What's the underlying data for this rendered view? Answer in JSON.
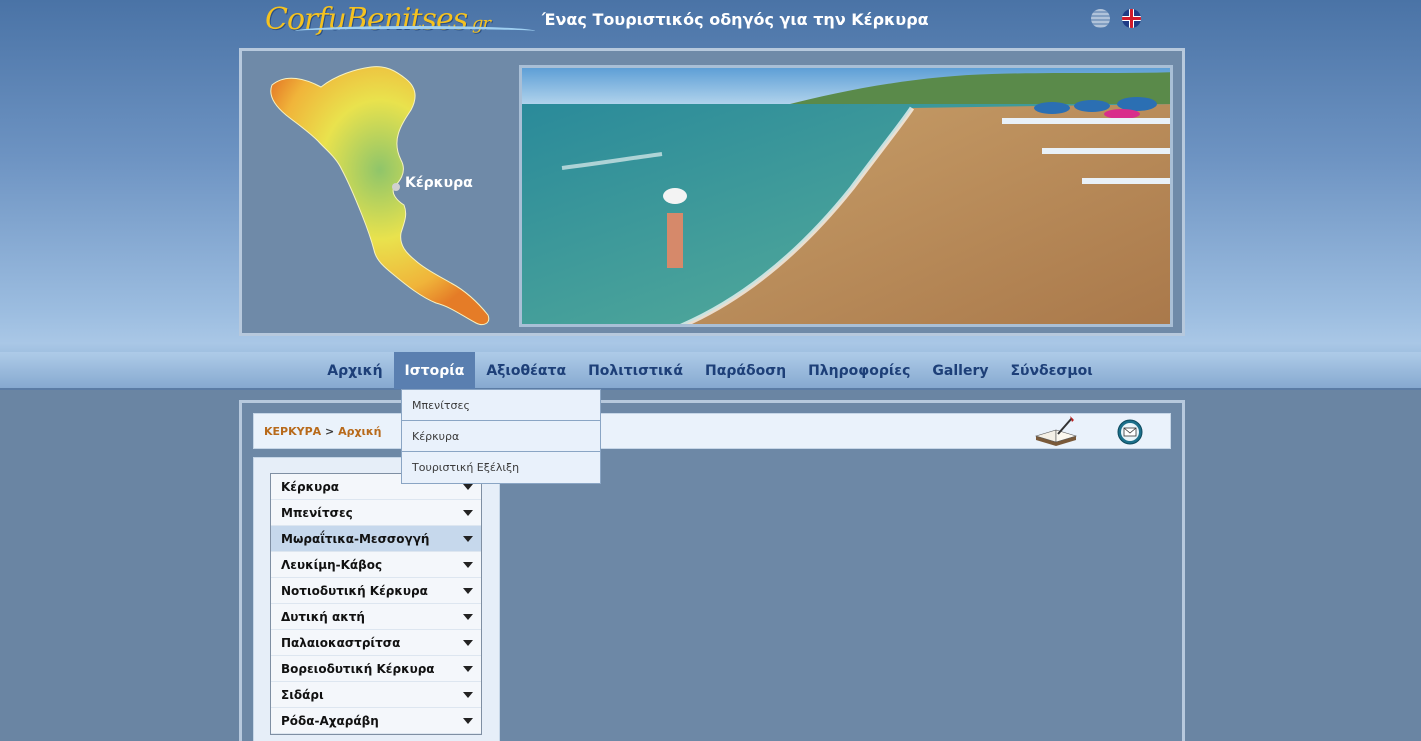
{
  "header": {
    "logo_text": "CorfuBenitses",
    "logo_suffix": ".gr",
    "tagline": "Ένας Τουριστικός οδηγός για την Κέρκυρα",
    "flags": [
      "greek-flag-icon",
      "uk-flag-icon"
    ]
  },
  "map": {
    "label": "Κέρκυρα"
  },
  "nav": {
    "items": [
      {
        "label": "Αρχική"
      },
      {
        "label": "Ιστορία"
      },
      {
        "label": "Αξιοθέατα"
      },
      {
        "label": "Πολιτιστικά"
      },
      {
        "label": "Παράδοση"
      },
      {
        "label": "Πληροφορίες"
      },
      {
        "label": "Gallery"
      },
      {
        "label": "Σύνδεσμοι"
      }
    ],
    "active_index": 1
  },
  "dropdown": {
    "items": [
      {
        "label": "Μπενίτσες"
      },
      {
        "label": "Κέρκυρα"
      },
      {
        "label": "Τουριστική Εξέλιξη"
      }
    ]
  },
  "breadcrumb": {
    "root": "ΚΕΡΚΥΡΑ",
    "separator": ">",
    "current": "Αρχική"
  },
  "sidebar": {
    "items": [
      {
        "label": "Κέρκυρα"
      },
      {
        "label": "Μπενίτσες"
      },
      {
        "label": "Μωραΐτικα-Μεσσογγή"
      },
      {
        "label": "Λευκίμη-Κάβος"
      },
      {
        "label": "Νοτιοδυτική Κέρκυρα"
      },
      {
        "label": "Δυτική ακτή"
      },
      {
        "label": "Παλαιοκαστρίτσα"
      },
      {
        "label": "Βορειοδυτική Κέρκυρα"
      },
      {
        "label": "Σιδάρι"
      },
      {
        "label": "Ρόδα-Αχαράβη"
      }
    ],
    "highlighted_index": 2
  },
  "colors": {
    "nav_text": "#1d3f78",
    "nav_active_bg": "#5a7fb0",
    "breadcrumb_text": "#b86a1b",
    "logo": "#f5c21f"
  }
}
